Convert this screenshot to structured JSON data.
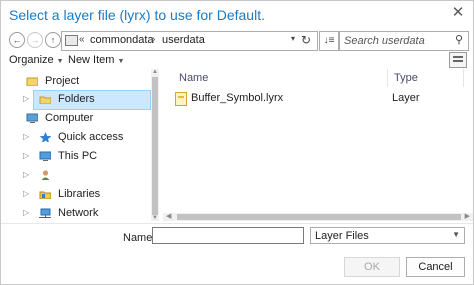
{
  "dialog": {
    "title": "Select a layer file (lyrx) to use for Default."
  },
  "nav": {
    "back_icon": "arrow-left-icon",
    "forward_icon": "arrow-right-icon",
    "up_icon": "arrow-up-icon",
    "path_prefix": "«",
    "path": [
      "commondata",
      "userdata"
    ],
    "separator": "›",
    "search_placeholder": "Search userdata"
  },
  "toolbar": {
    "organize": "Organize",
    "new_item": "New Item"
  },
  "tree": {
    "items": [
      {
        "label": "Project",
        "icon": "project-icon",
        "expander": ""
      },
      {
        "label": "Folders",
        "icon": "folder-icon",
        "expander": "▷",
        "selected": true
      },
      {
        "label": "Computer",
        "icon": "computer-icon",
        "expander": ""
      },
      {
        "label": "Quick access",
        "icon": "star-icon",
        "expander": "▷"
      },
      {
        "label": "This PC",
        "icon": "monitor-icon",
        "expander": "▷"
      },
      {
        "label": "",
        "icon": "user-icon",
        "expander": "▷"
      },
      {
        "label": "Libraries",
        "icon": "libraries-icon",
        "expander": "▷"
      },
      {
        "label": "Network",
        "icon": "network-icon",
        "expander": "▷"
      }
    ]
  },
  "files": {
    "columns": [
      "Name",
      "Type"
    ],
    "rows": [
      {
        "name": "Buffer_Symbol.lyrx",
        "type": "Layer",
        "icon": "layer-file-icon"
      }
    ]
  },
  "footer": {
    "name_label": "Name",
    "name_value": "",
    "filter_value": "Layer Files",
    "ok_label": "OK",
    "cancel_label": "Cancel"
  },
  "colors": {
    "title": "#1a7bc6",
    "selection": "#cce8ff"
  }
}
